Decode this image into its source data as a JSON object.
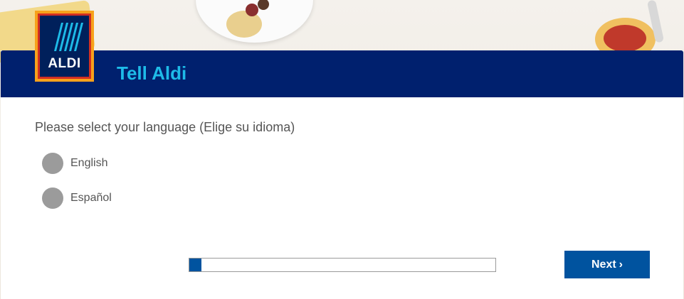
{
  "header": {
    "title": "Tell Aldi",
    "logo_text": "ALDI"
  },
  "survey": {
    "question": "Please select your language (Elige su idioma)",
    "options": [
      {
        "label": "English",
        "selected": false
      },
      {
        "label": "Español",
        "selected": false
      }
    ]
  },
  "progress": {
    "fraction": 0.04
  },
  "footer": {
    "next_label": "Next",
    "next_icon": "chevron-right-icon"
  },
  "colors": {
    "header_bg": "#00206e",
    "title": "#1ebbe8",
    "button_bg": "#00539f",
    "radio": "#9b9b9b"
  }
}
